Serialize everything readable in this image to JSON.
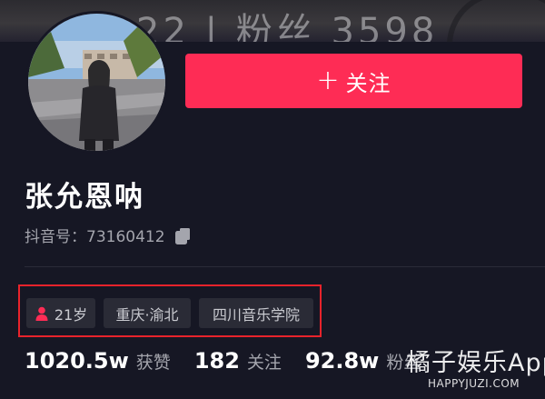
{
  "banner": {
    "overlay_text": "22 | 粉丝 3598"
  },
  "profile": {
    "follow_label": "关注",
    "follow_icon": "plus-icon",
    "name": "张允恩呐",
    "douyin_id": "抖音号：73160412",
    "copy_icon": "copy-icon"
  },
  "tags": {
    "age": "21岁",
    "gender_icon": "female-icon",
    "location": "重庆·渝北",
    "school": "四川音乐学院"
  },
  "stats": [
    {
      "value": "1020.5w",
      "label": "获赞"
    },
    {
      "value": "182",
      "label": "关注"
    },
    {
      "value": "92.8w",
      "label": "粉丝"
    }
  ],
  "watermark": {
    "logo": "橘子娱乐App",
    "url": "HAPPYJUZI.COM"
  },
  "colors": {
    "accent": "#fe2c55",
    "background": "#161724",
    "highlight_box": "#e8232b",
    "tag_bg": "#2a2b36"
  }
}
